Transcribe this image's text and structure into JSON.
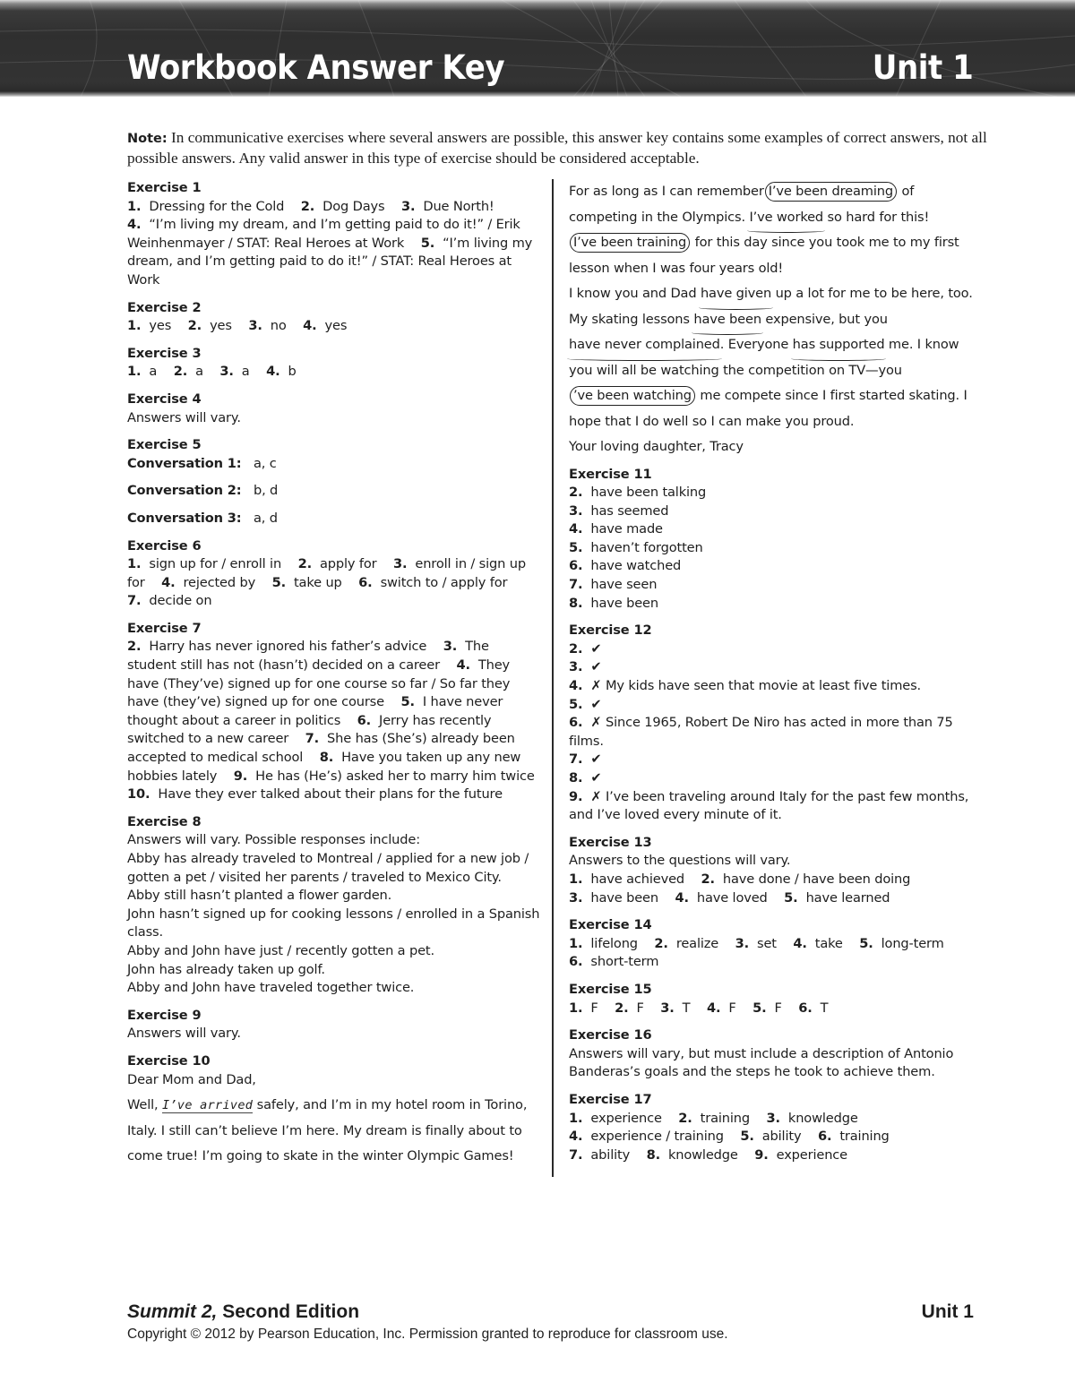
{
  "header": {
    "title": "Workbook Answer Key",
    "unit": "Unit 1",
    "background_color": "#2f2f2f"
  },
  "note": {
    "label": "Note:",
    "text": "In communicative exercises where several answers are possible, this answer key contains some examples of correct answers, not all possible answers. Any valid answer in this type of exercise should be considered acceptable."
  },
  "exercises": {
    "ex1": {
      "title": "Exercise 1",
      "items": [
        {
          "n": "1.",
          "text": "Dressing for the Cold"
        },
        {
          "n": "2.",
          "text": "Dog Days"
        },
        {
          "n": "3.",
          "text": "Due North!"
        },
        {
          "n": "4.",
          "text": "“I’m living my dream, and I’m getting paid to do it!” / Erik Weinhenmayer  / STAT: Real Heroes at Work"
        },
        {
          "n": "5.",
          "text": "“I’m living my dream, and I’m getting paid to do it!” / STAT: Real Heroes at Work"
        }
      ]
    },
    "ex2": {
      "title": "Exercise 2",
      "items": [
        {
          "n": "1.",
          "text": "yes"
        },
        {
          "n": "2.",
          "text": "yes"
        },
        {
          "n": "3.",
          "text": "no"
        },
        {
          "n": "4.",
          "text": "yes"
        }
      ]
    },
    "ex3": {
      "title": "Exercise 3",
      "items": [
        {
          "n": "1.",
          "text": "a"
        },
        {
          "n": "2.",
          "text": "a"
        },
        {
          "n": "3.",
          "text": "a"
        },
        {
          "n": "4.",
          "text": "b"
        }
      ]
    },
    "ex4": {
      "title": "Exercise 4",
      "text": "Answers will vary."
    },
    "ex5": {
      "title": "Exercise 5",
      "conversations": [
        {
          "label": "Conversation 1:",
          "answer": "a, c"
        },
        {
          "label": "Conversation 2:",
          "answer": "b, d"
        },
        {
          "label": "Conversation 3:",
          "answer": "a, d"
        }
      ]
    },
    "ex6": {
      "title": "Exercise 6",
      "items": [
        {
          "n": "1.",
          "text": "sign up for  / enroll in"
        },
        {
          "n": "2.",
          "text": "apply for"
        },
        {
          "n": "3.",
          "text": "enroll in  / sign up for"
        },
        {
          "n": "4.",
          "text": "rejected by"
        },
        {
          "n": "5.",
          "text": "take up"
        },
        {
          "n": "6.",
          "text": "switch to  / apply for"
        },
        {
          "n": "7.",
          "text": "decide on"
        }
      ]
    },
    "ex7": {
      "title": "Exercise 7",
      "items": [
        {
          "n": "2.",
          "text": "Harry has never ignored his father’s advice"
        },
        {
          "n": "3.",
          "text": "The student still has not (hasn’t) decided on a career"
        },
        {
          "n": "4.",
          "text": "They have (They’ve) signed up for one course so far  / So far they have (they’ve) signed up for one course"
        },
        {
          "n": "5.",
          "text": "I have never thought about a career in politics"
        },
        {
          "n": "6.",
          "text": "Jerry has recently switched to a new career"
        },
        {
          "n": "7.",
          "text": "She has (She’s) already been accepted to medical school"
        },
        {
          "n": "8.",
          "text": "Have you taken up any new hobbies lately"
        },
        {
          "n": "9.",
          "text": "He has (He’s) asked her to marry him twice"
        },
        {
          "n": "10.",
          "text": "Have they ever talked about their plans for the future"
        }
      ]
    },
    "ex8": {
      "title": "Exercise 8",
      "lines": [
        "Answers will vary.  Possible responses include:",
        "Abby has already traveled to Montreal  / applied for a new job  / gotten a pet  / visited her parents  / traveled to Mexico City.",
        "Abby still hasn’t planted a flower garden.",
        "John hasn’t signed up for cooking lessons  / enrolled in a Spanish class.",
        "Abby and John have just  / recently gotten a pet.",
        "John has already taken up golf.",
        "Abby and John have traveled together twice."
      ]
    },
    "ex9": {
      "title": "Exercise 9",
      "text": "Answers will vary."
    },
    "ex10": {
      "title": "Exercise 10",
      "greeting": "Dear Mom and Dad,",
      "p1_pre": "Well, ",
      "p1_handwritten": "I’ve arrived",
      "p1_post": " safely, and I’m in my hotel room in Torino, Italy.  I still can’t believe I’m here.  My dream is finally about to come true!  I’m going to skate in the winter Olympic Games!",
      "p2": {
        "a": "For as long as I can remember",
        "b_circled": "I’ve been dreaming",
        "c": " of competing in the Olympics.  ",
        "d_underlined": "I’ve worked",
        "e": " so hard for this! ",
        "f_circled": "I’ve been training",
        "g": " for this day since you took me to my first lesson when I was four years old!"
      },
      "p3": {
        "a": "I know you and Dad ",
        "b_underlined": "have given",
        "c": " up a lot for me to be here, too. My skating lessons ",
        "d_underlined": "have been",
        "e": " expensive, but you ",
        "f_underlined": "have never complained",
        "g": ".  Everyone ",
        "h_underlined": "has supported",
        "i": " me.  I know you will all be watching the competition on TV—you",
        "j_circled": "’ve been watching",
        "k": " me compete since I first started skating.  I hope that I do well so I can make you proud."
      },
      "closing": "Your loving daughter, Tracy"
    },
    "ex11": {
      "title": "Exercise 11",
      "items": [
        {
          "n": "2.",
          "text": "have been talking"
        },
        {
          "n": "3.",
          "text": "has seemed"
        },
        {
          "n": "4.",
          "text": "have made"
        },
        {
          "n": "5.",
          "text": "haven’t forgotten"
        },
        {
          "n": "6.",
          "text": "have watched"
        },
        {
          "n": "7.",
          "text": "have seen"
        },
        {
          "n": "8.",
          "text": "have been"
        }
      ]
    },
    "ex12": {
      "title": "Exercise 12",
      "check_glyph": "✔",
      "cross_glyph": "✗",
      "items": [
        {
          "n": "2.",
          "mark": "check",
          "text": ""
        },
        {
          "n": "3.",
          "mark": "check",
          "text": ""
        },
        {
          "n": "4.",
          "mark": "cross",
          "text": "My kids have seen that movie at least five times."
        },
        {
          "n": "5.",
          "mark": "check",
          "text": ""
        },
        {
          "n": "6.",
          "mark": "cross",
          "text": " Since 1965, Robert De Niro has acted in more than 75 films."
        },
        {
          "n": "7.",
          "mark": "check",
          "text": ""
        },
        {
          "n": "8.",
          "mark": "check",
          "text": ""
        },
        {
          "n": "9.",
          "mark": "cross",
          "text": "I’ve been traveling around Italy for the past few months, and I’ve loved every minute of it."
        }
      ]
    },
    "ex13": {
      "title": "Exercise 13",
      "intro": "Answers to the questions will vary.",
      "items": [
        {
          "n": "1.",
          "text": "have achieved"
        },
        {
          "n": "2.",
          "text": "have done  / have been doing"
        },
        {
          "n": "3.",
          "text": "have been"
        },
        {
          "n": "4.",
          "text": "have loved"
        },
        {
          "n": "5.",
          "text": "have learned"
        }
      ]
    },
    "ex14": {
      "title": "Exercise 14",
      "items": [
        {
          "n": "1.",
          "text": "lifelong"
        },
        {
          "n": "2.",
          "text": "realize"
        },
        {
          "n": "3.",
          "text": "set"
        },
        {
          "n": "4.",
          "text": "take"
        },
        {
          "n": "5.",
          "text": "long-term"
        },
        {
          "n": "6.",
          "text": "short-term"
        }
      ]
    },
    "ex15": {
      "title": "Exercise 15",
      "items": [
        {
          "n": "1.",
          "text": "F"
        },
        {
          "n": "2.",
          "text": "F"
        },
        {
          "n": "3.",
          "text": "T"
        },
        {
          "n": "4.",
          "text": "F"
        },
        {
          "n": "5.",
          "text": "F"
        },
        {
          "n": "6.",
          "text": "T"
        }
      ]
    },
    "ex16": {
      "title": "Exercise 16",
      "text": "Answers will vary, but must include a description of Antonio Banderas’s goals and the steps he took to achieve them."
    },
    "ex17": {
      "title": "Exercise 17",
      "items": [
        {
          "n": "1.",
          "text": "experience"
        },
        {
          "n": "2.",
          "text": "training"
        },
        {
          "n": "3.",
          "text": "knowledge"
        },
        {
          "n": "4.",
          "text": "experience / training"
        },
        {
          "n": "5.",
          "text": "ability"
        },
        {
          "n": "6.",
          "text": "training"
        },
        {
          "n": "7.",
          "text": "ability"
        },
        {
          "n": "8.",
          "text": "knowledge"
        },
        {
          "n": "9.",
          "text": "experience"
        }
      ]
    }
  },
  "footer": {
    "book_title_italic": "Summit 2,",
    "book_title_rest": " Second Edition",
    "unit": "Unit 1",
    "copyright": "Copyright © 2012 by Pearson Education, Inc. Permission granted to reproduce for classroom use."
  }
}
